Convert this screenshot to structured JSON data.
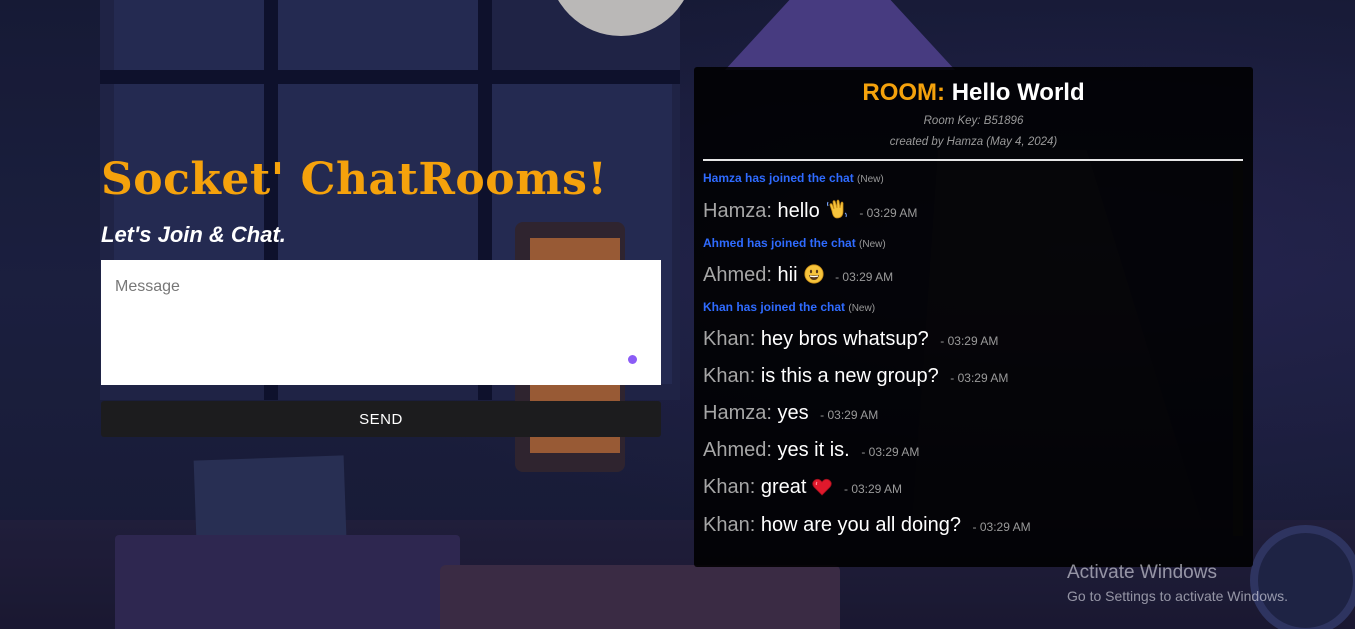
{
  "site": {
    "title": "Socket' ChatRooms!",
    "tagline": "Let's Join & Chat."
  },
  "composer": {
    "placeholder": "Message",
    "send_label": "SEND"
  },
  "room": {
    "label": "ROOM:",
    "name": "Hello World",
    "key_text": "Room Key: B51896",
    "created_text": "created by Hamza (May 4, 2024)"
  },
  "feed": [
    {
      "type": "system",
      "text": "Hamza has joined the chat",
      "tag": "(New)"
    },
    {
      "type": "message",
      "user": "Hamza",
      "text": "hello",
      "emoji": "waving-hand-icon",
      "time": "- 03:29 AM"
    },
    {
      "type": "system",
      "text": "Ahmed has joined the chat",
      "tag": "(New)"
    },
    {
      "type": "message",
      "user": "Ahmed",
      "text": "hii",
      "emoji": "grinning-face-icon",
      "time": "- 03:29 AM"
    },
    {
      "type": "system",
      "text": "Khan has joined the chat",
      "tag": "(New)"
    },
    {
      "type": "message",
      "user": "Khan",
      "text": "hey bros whatsup?",
      "time": "- 03:29 AM"
    },
    {
      "type": "message",
      "user": "Khan",
      "text": "is this a new group?",
      "time": "- 03:29 AM"
    },
    {
      "type": "message",
      "user": "Hamza",
      "text": "yes",
      "time": "- 03:29 AM"
    },
    {
      "type": "message",
      "user": "Ahmed",
      "text": "yes it is.",
      "time": "- 03:29 AM"
    },
    {
      "type": "message",
      "user": "Khan",
      "text": "great",
      "emoji": "red-heart-icon",
      "time": "- 03:29 AM"
    },
    {
      "type": "message",
      "user": "Khan",
      "text": "how are you all doing?",
      "time": "- 03:29 AM"
    }
  ],
  "watermark": {
    "line1": "Activate Windows",
    "line2": "Go to Settings to activate Windows."
  },
  "colors": {
    "accent": "#f5a20c",
    "system_text": "#2f6bff",
    "input_dot": "#8b5cf6"
  }
}
